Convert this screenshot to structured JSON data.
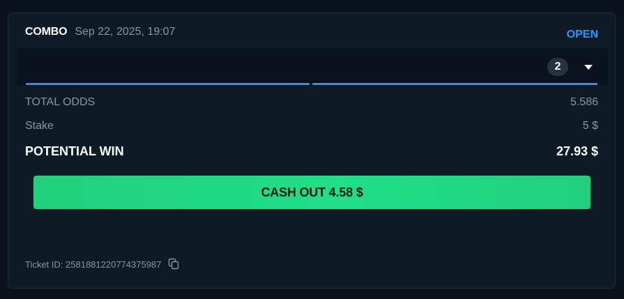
{
  "bet": {
    "type": "COMBO",
    "date": "Sep 22, 2025, 19:07",
    "status": "OPEN",
    "selection_count": "2"
  },
  "summary": {
    "total_odds_label": "TOTAL ODDS",
    "total_odds_value": "5.586",
    "stake_label": "Stake",
    "stake_value": "5 $",
    "potential_win_label": "POTENTIAL WIN",
    "potential_win_value": "27.93 $"
  },
  "cashout": {
    "label": "CASH OUT 4.58 $"
  },
  "ticket": {
    "id_text": "Ticket ID: 2581881220774375987"
  },
  "icons": {
    "expand": "chevron-down-icon",
    "copy": "copy-icon"
  },
  "colors": {
    "status_open": "#1e9bff",
    "cashout_green": "#20df86",
    "progress_blue": "#3a8de0",
    "card_bg": "#0e1a26"
  }
}
